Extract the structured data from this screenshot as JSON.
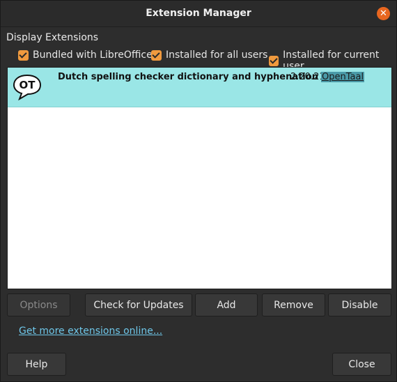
{
  "window": {
    "title": "Extension Manager"
  },
  "filters": {
    "section_label": "Display Extensions",
    "bundled": "Bundled with LibreOffice",
    "all_users": "Installed for all users",
    "current_user": "Installed for current user"
  },
  "extensions": [
    {
      "title": "Dutch spelling checker dictionary and hyphenation p...",
      "version": "2.20.21",
      "publisher": "OpenTaal",
      "logo_text": "OT"
    }
  ],
  "buttons": {
    "options": "Options",
    "check_updates": "Check for Updates",
    "add": "Add",
    "remove": "Remove",
    "disable": "Disable",
    "help": "Help",
    "close": "Close"
  },
  "links": {
    "get_more": "Get more extensions online..."
  },
  "colors": {
    "accent": "#f09a3e",
    "selection": "#9ae6e6",
    "link": "#6ec6e8"
  }
}
